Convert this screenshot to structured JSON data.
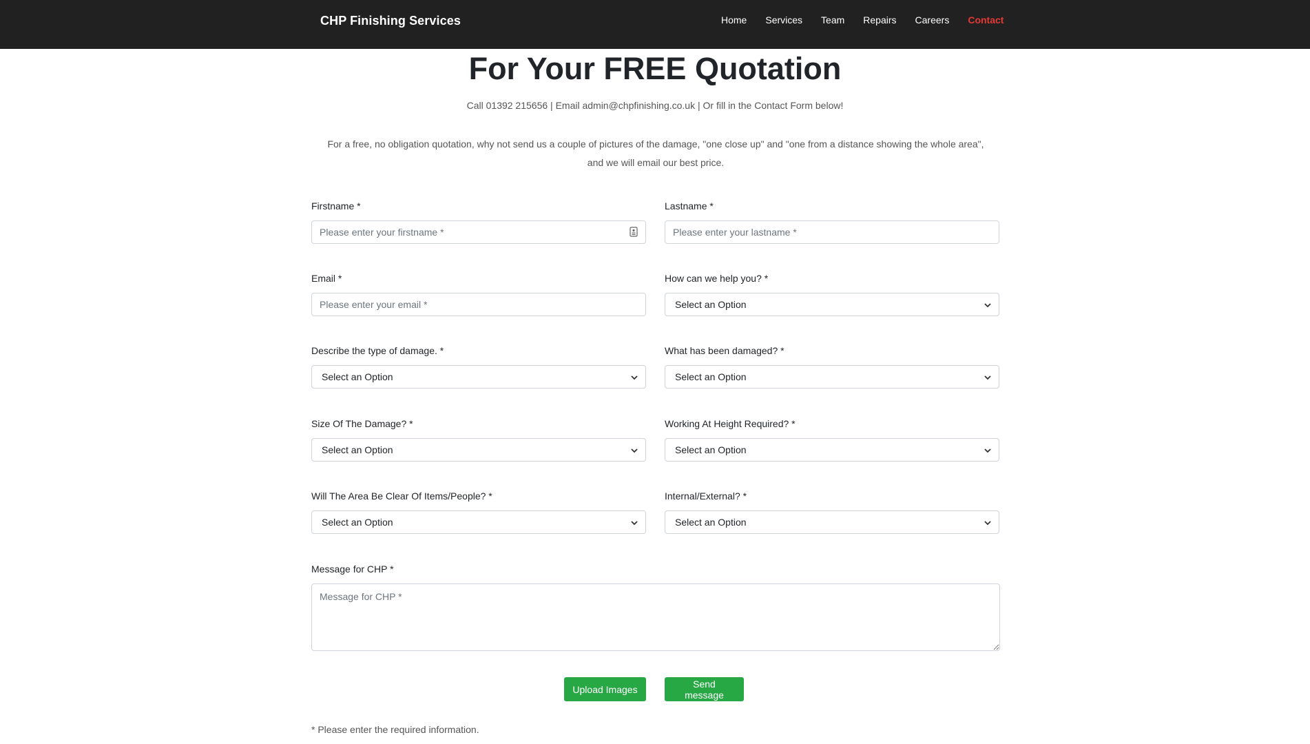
{
  "navbar": {
    "brand": "CHP Finishing Services",
    "links": [
      {
        "label": "Home"
      },
      {
        "label": "Services"
      },
      {
        "label": "Team"
      },
      {
        "label": "Repairs"
      },
      {
        "label": "Careers"
      },
      {
        "label": "Contact",
        "active": true
      }
    ],
    "active_color": "#e53935",
    "background": "#212121"
  },
  "header": {
    "title": "For Your FREE Quotation",
    "contact_line": "Call 01392 215656 | Email admin@chpfinishing.co.uk | Or fill in the Contact Form below!",
    "intro_line1": "For a free, no obligation quotation, why not send us a couple of pictures of the damage, \"one close up\" and \"one from a distance showing the whole area\",",
    "intro_line2": "and we will email our best price."
  },
  "form": {
    "firstname": {
      "label": "Firstname *",
      "placeholder": "Please enter your firstname *"
    },
    "lastname": {
      "label": "Lastname *",
      "placeholder": "Please enter your lastname *"
    },
    "email": {
      "label": "Email *",
      "placeholder": "Please enter your email *"
    },
    "help": {
      "label": "How can we help you? *",
      "value": "Select an Option"
    },
    "damage_type": {
      "label": "Describe the type of damage. *",
      "value": "Select an Option"
    },
    "damaged_item": {
      "label": "What has been damaged? *",
      "value": "Select an Option"
    },
    "damage_size": {
      "label": "Size Of The Damage? *",
      "value": "Select an Option"
    },
    "height": {
      "label": "Working At Height Required? *",
      "value": "Select an Option"
    },
    "clear_area": {
      "label": "Will The Area Be Clear Of Items/People? *",
      "value": "Select an Option"
    },
    "int_ext": {
      "label": "Internal/External? *",
      "value": "Select an Option"
    },
    "message": {
      "label": "Message for CHP *",
      "placeholder": "Message for CHP *"
    },
    "upload_label": "Upload Images",
    "send_label": "Send message",
    "required_note": "* Please enter the required information."
  },
  "colors": {
    "button": "#28a745",
    "border": "#ced4da"
  }
}
